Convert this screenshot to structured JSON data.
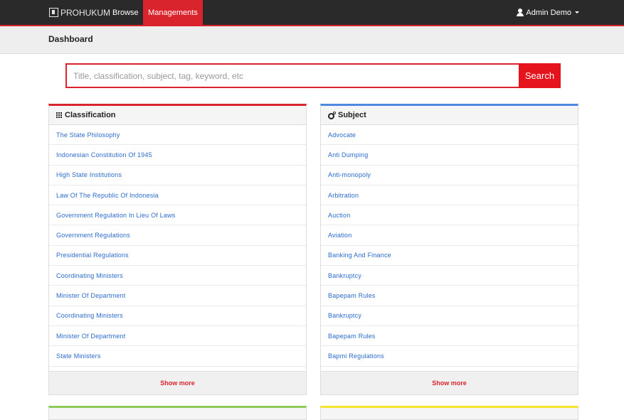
{
  "navbar": {
    "brand": "PROHUKUM",
    "links": {
      "browse": "Browse",
      "managements": "Managements"
    },
    "user": "Admin Demo"
  },
  "header": {
    "title": "Dashboard"
  },
  "search": {
    "placeholder": "Title, classification, subject, tag, keyword, etc",
    "button": "Search"
  },
  "classification": {
    "title": "Classification",
    "items": [
      "The State Philosophy",
      "Indonesian Constitution Of 1945",
      "High State Institutions",
      "Law Of The Republic Of Indonesia",
      "Government Regulation In Lieu Of Laws",
      "Government Regulations",
      "Presidential Regulations",
      "Coordinating Ministers",
      "Minister Of Department",
      "Coordinating Ministers",
      "Minister Of Department",
      "State Ministers"
    ],
    "show_more": "Show more"
  },
  "subject": {
    "title": "Subject",
    "items": [
      "Advocate",
      "Anti Dumping",
      "Anti-monopoly",
      "Arbitration",
      "Auction",
      "Aviation",
      "Banking And Finance",
      "Bankruptcy",
      "Bapepam Rules",
      "Bankruptcy",
      "Bapepam Rules",
      "Bapmi Regulations"
    ],
    "show_more": "Show more"
  },
  "colors": {
    "accent": "#d9232d",
    "subject_accent": "#4d8ae0",
    "link": "#2a6ac8"
  }
}
